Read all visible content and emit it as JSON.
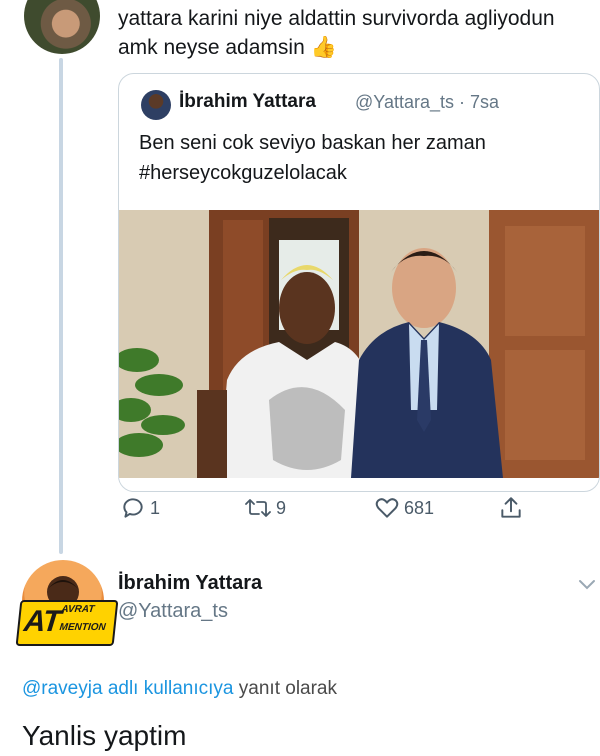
{
  "top_tweet": {
    "text": "yattara karini niye aldattin survivorda agliyodun amk neyse adamsin",
    "emoji": "👍"
  },
  "quoted_tweet": {
    "name": "İbrahim Yattara",
    "handle": "@Yattara_ts",
    "time": "· 7sa",
    "text_line1": "Ben seni cok seviyo baskan her zaman",
    "text_line2": "#herseycokguzelolacak"
  },
  "actions": {
    "replies": "1",
    "retweets": "9",
    "likes": "681"
  },
  "reply_tweet": {
    "name": "İbrahim Yattara",
    "handle": "@Yattara_ts",
    "badge_main": "AT",
    "badge_top": "AVRAT",
    "badge_bottom": "MENTION",
    "reply_to_user": "@raveyja adlı kullanıcıya",
    "reply_to_suffix": " yanıt olarak",
    "text": "Yanlis yaptim"
  },
  "colors": {
    "link": "#1b95e0",
    "muted": "#657786",
    "thread_line": "#c8d6e3",
    "badge": "#ffd200"
  },
  "icons": [
    "reply-icon",
    "retweet-icon",
    "like-icon",
    "share-icon",
    "chevron-down-icon"
  ]
}
